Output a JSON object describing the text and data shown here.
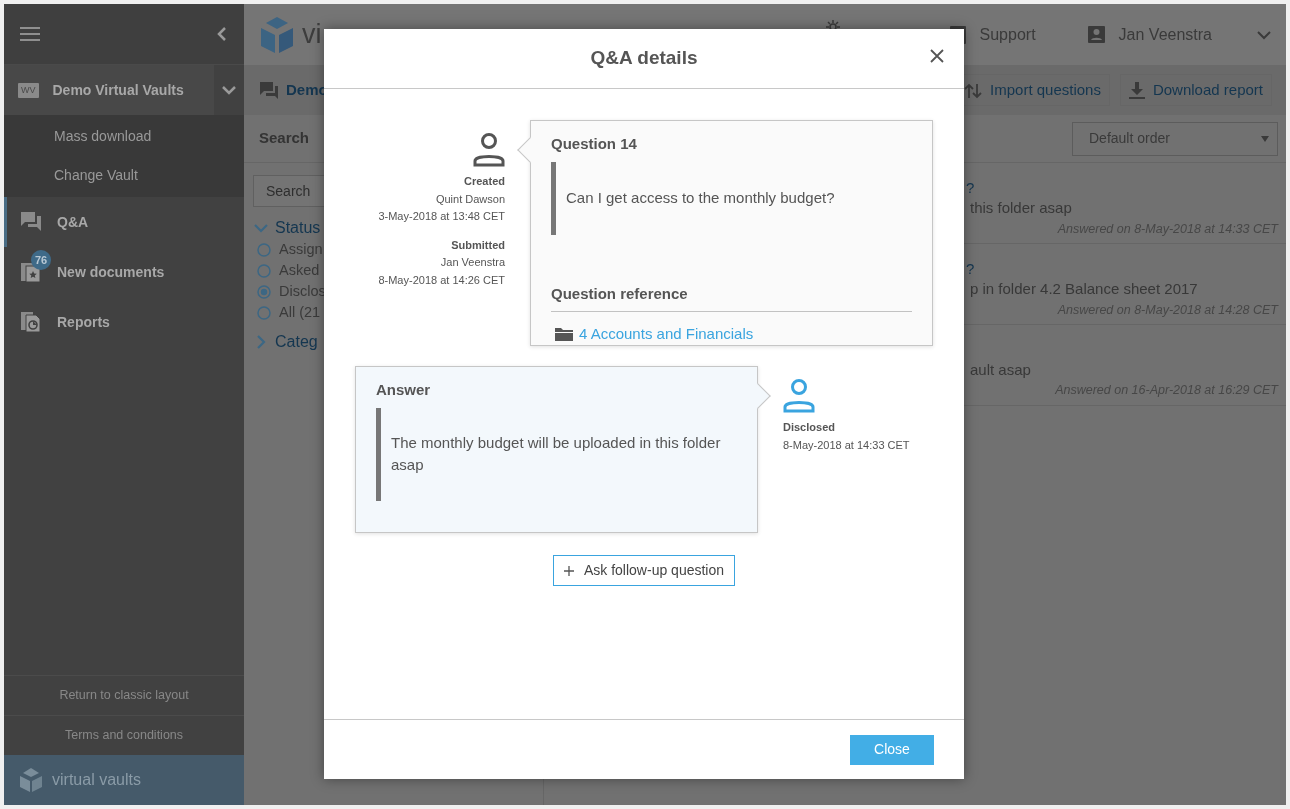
{
  "sidebar": {
    "vault": {
      "logo": "WV",
      "label": "Demo Virtual Vaults",
      "expanded": true,
      "children": [
        {
          "label": "Mass download"
        },
        {
          "label": "Change Vault"
        }
      ]
    },
    "items": [
      {
        "kind": "qa",
        "label": "Q&A",
        "selected": true
      },
      {
        "kind": "docs",
        "label": "New documents",
        "badge": "76",
        "selected": false
      },
      {
        "kind": "reports",
        "label": "Reports",
        "selected": false
      }
    ],
    "footer_links": [
      "Return to classic layout",
      "Terms and conditions"
    ],
    "brand": "virtual vaults"
  },
  "header": {
    "brand_fragment": "vi",
    "support": "Support",
    "user": "Jan Veenstra"
  },
  "toolbar": {
    "tab_fragment": "Demo",
    "actions": [
      {
        "kind": "import",
        "label": "Import questions"
      },
      {
        "kind": "download",
        "label": "Download report"
      }
    ]
  },
  "search_label": "Search",
  "sort": {
    "value": "Default order"
  },
  "filters": {
    "search_placeholder": "Search",
    "groups": [
      {
        "label": "Status",
        "expanded": true,
        "options": [
          {
            "label": "Assign",
            "selected": false
          },
          {
            "label": "Asked",
            "selected": false
          },
          {
            "label": "Disclos",
            "selected": true
          },
          {
            "label": "All (21",
            "selected": false
          }
        ]
      },
      {
        "label": "Categ",
        "expanded": false
      }
    ]
  },
  "list": [
    {
      "title": "?",
      "text": "this folder asap",
      "answered": "Answered on 8-May-2018 at 14:33 CET"
    },
    {
      "title": "?",
      "text": "p in folder 4.2 Balance sheet 2017",
      "answered": "Answered on 8-May-2018 at 14:28 CET"
    },
    {
      "text": "ault asap",
      "answered": "Answered on 16-Apr-2018 at 16:29 CET"
    }
  ],
  "modal": {
    "title": "Q&A details",
    "question": {
      "heading": "Question 14",
      "text": "Can I get access to the monthly budget?",
      "reference_label": "Question reference",
      "reference": "4 Accounts and Financials",
      "events": [
        {
          "label": "Created",
          "person": "Quint Dawson",
          "time": "3-May-2018 at 13:48 CET"
        },
        {
          "label": "Submitted",
          "person": "Jan Veenstra",
          "time": "8-May-2018 at 14:26 CET"
        }
      ]
    },
    "answer": {
      "heading": "Answer",
      "text": "The monthly budget will be uploaded in this folder asap",
      "events": [
        {
          "label": "Disclosed",
          "time": "8-May-2018 at 14:33 CET"
        }
      ]
    },
    "follow_up": "Ask follow-up question",
    "close": "Close"
  }
}
